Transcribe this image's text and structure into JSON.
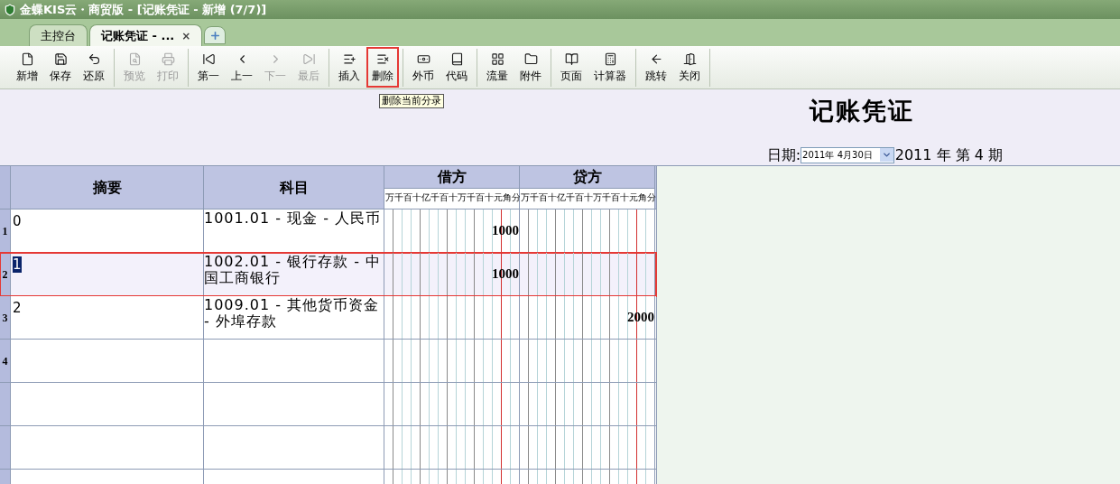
{
  "window": {
    "title": "金蝶KIS云・商贸版 - [记账凭证 - 新增 (7/7)]"
  },
  "tabs": [
    {
      "label": "主控台",
      "selected": false
    },
    {
      "label": "记账凭证 - ...",
      "selected": true,
      "close": "×"
    }
  ],
  "toolbar": {
    "groups": [
      [
        {
          "label": "新增",
          "disabled": false,
          "highlighted": false
        },
        {
          "label": "保存",
          "disabled": false,
          "highlighted": false
        },
        {
          "label": "还原",
          "disabled": false,
          "highlighted": false
        }
      ],
      [
        {
          "label": "预览",
          "disabled": true,
          "highlighted": false
        },
        {
          "label": "打印",
          "disabled": true,
          "highlighted": false
        }
      ],
      [
        {
          "label": "第一",
          "disabled": false,
          "highlighted": false
        },
        {
          "label": "上一",
          "disabled": false,
          "highlighted": false
        },
        {
          "label": "下一",
          "disabled": true,
          "highlighted": false
        },
        {
          "label": "最后",
          "disabled": true,
          "highlighted": false
        }
      ],
      [
        {
          "label": "插入",
          "disabled": false,
          "highlighted": false
        },
        {
          "label": "删除",
          "disabled": false,
          "highlighted": true,
          "tooltip": "删除当前分录"
        }
      ],
      [
        {
          "label": "外币",
          "disabled": false,
          "highlighted": false
        },
        {
          "label": "代码",
          "disabled": false,
          "highlighted": false
        }
      ],
      [
        {
          "label": "流量",
          "disabled": false,
          "highlighted": false
        },
        {
          "label": "附件",
          "disabled": false,
          "highlighted": false
        }
      ],
      [
        {
          "label": "页面",
          "disabled": false,
          "highlighted": false
        },
        {
          "label": "计算器",
          "disabled": false,
          "highlighted": false
        }
      ],
      [
        {
          "label": "跳转",
          "disabled": false,
          "highlighted": false
        },
        {
          "label": "关闭",
          "disabled": false,
          "highlighted": false
        }
      ]
    ]
  },
  "voucher": {
    "title": "记账凭证",
    "date_label": "日期:",
    "date_value": "2011年 4月30日",
    "period": "2011 年 第 4 期"
  },
  "table": {
    "columns": [
      {
        "label": "摘要"
      },
      {
        "label": "科目"
      },
      {
        "label": "借方",
        "units": [
          "万",
          "千",
          "百",
          "十",
          "亿",
          "千",
          "百",
          "十",
          "万",
          "千",
          "百",
          "十",
          "元",
          "角",
          "分"
        ]
      },
      {
        "label": "贷方",
        "units": [
          "万",
          "千",
          "百",
          "十",
          "亿",
          "千",
          "百",
          "十",
          "万",
          "千",
          "百",
          "十",
          "元",
          "角",
          "分"
        ]
      }
    ],
    "rows": [
      {
        "number": "1",
        "summary": "0",
        "account": "1001.01 - 现金 - 人民币",
        "debit": "1000",
        "selected": false,
        "highlighted": false
      },
      {
        "number": "2",
        "summary": "1",
        "account": "1002.01 - 银行存款 - 中国工商银行",
        "debit": "1000",
        "selected": true,
        "highlighted": true
      },
      {
        "number": "3",
        "summary": "2",
        "account": "1009.01 - 其他货币资金 - 外埠存款",
        "credit": "2000",
        "selected": false,
        "highlighted": false
      },
      {
        "number": "4",
        "selected": false,
        "highlighted": false
      }
    ]
  }
}
